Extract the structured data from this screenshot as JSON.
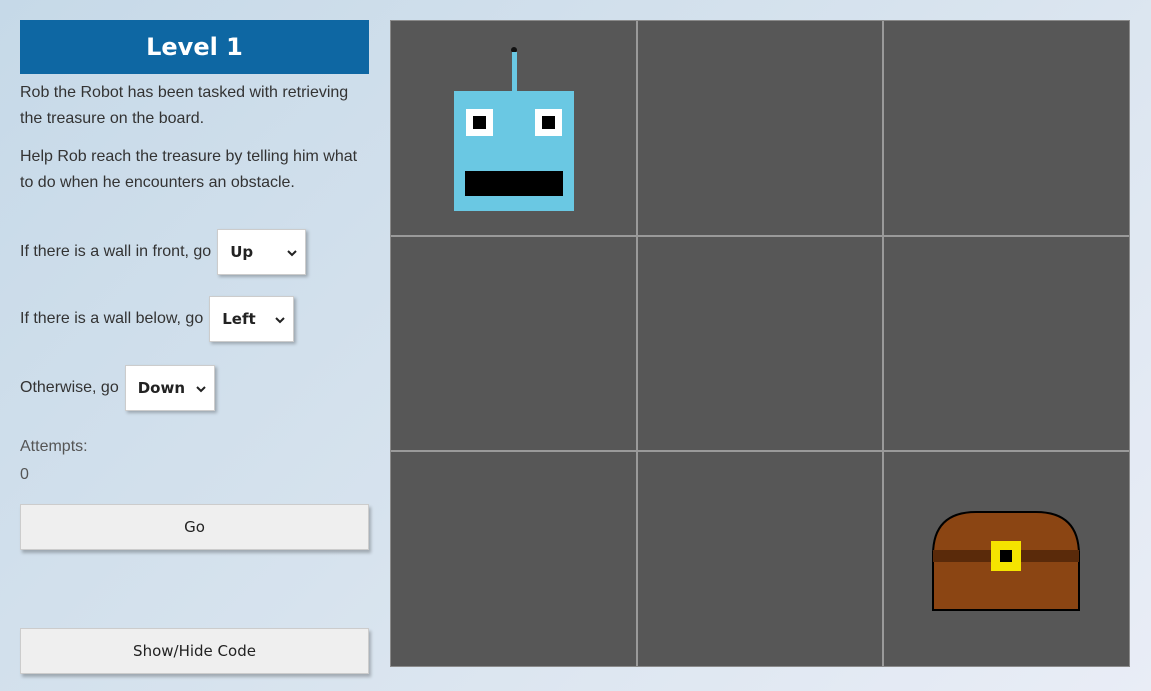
{
  "level": {
    "title": "Level 1"
  },
  "description": {
    "p1": "Rob the Robot has been tasked with retrieving the treasure on the board.",
    "p2": "Help Rob reach the treasure by telling him what to do when he encounters an obstacle."
  },
  "rules": {
    "wall_front": {
      "label": "If there is a wall in front, go",
      "value": "Up"
    },
    "wall_below": {
      "label": "If there is a wall below, go",
      "value": "Left"
    },
    "otherwise": {
      "label": "Otherwise, go",
      "value": "Down"
    }
  },
  "attempts": {
    "label": "Attempts:",
    "value": "0"
  },
  "buttons": {
    "go": "Go",
    "show_hide_code": "Show/Hide Code"
  },
  "board": {
    "rows": 3,
    "cols": 3,
    "robot_cell": [
      0,
      0
    ],
    "treasure_cell": [
      2,
      2
    ],
    "colors": {
      "cell": "#575757",
      "grid_line": "#9a9a9a",
      "robot": "#6ac8e3",
      "chest": "#8b4513",
      "chest_lock": "#f5e400",
      "title_bar": "#0e67a3"
    },
    "icons": {
      "robot": "robot-icon",
      "treasure": "treasure-chest-icon"
    }
  }
}
